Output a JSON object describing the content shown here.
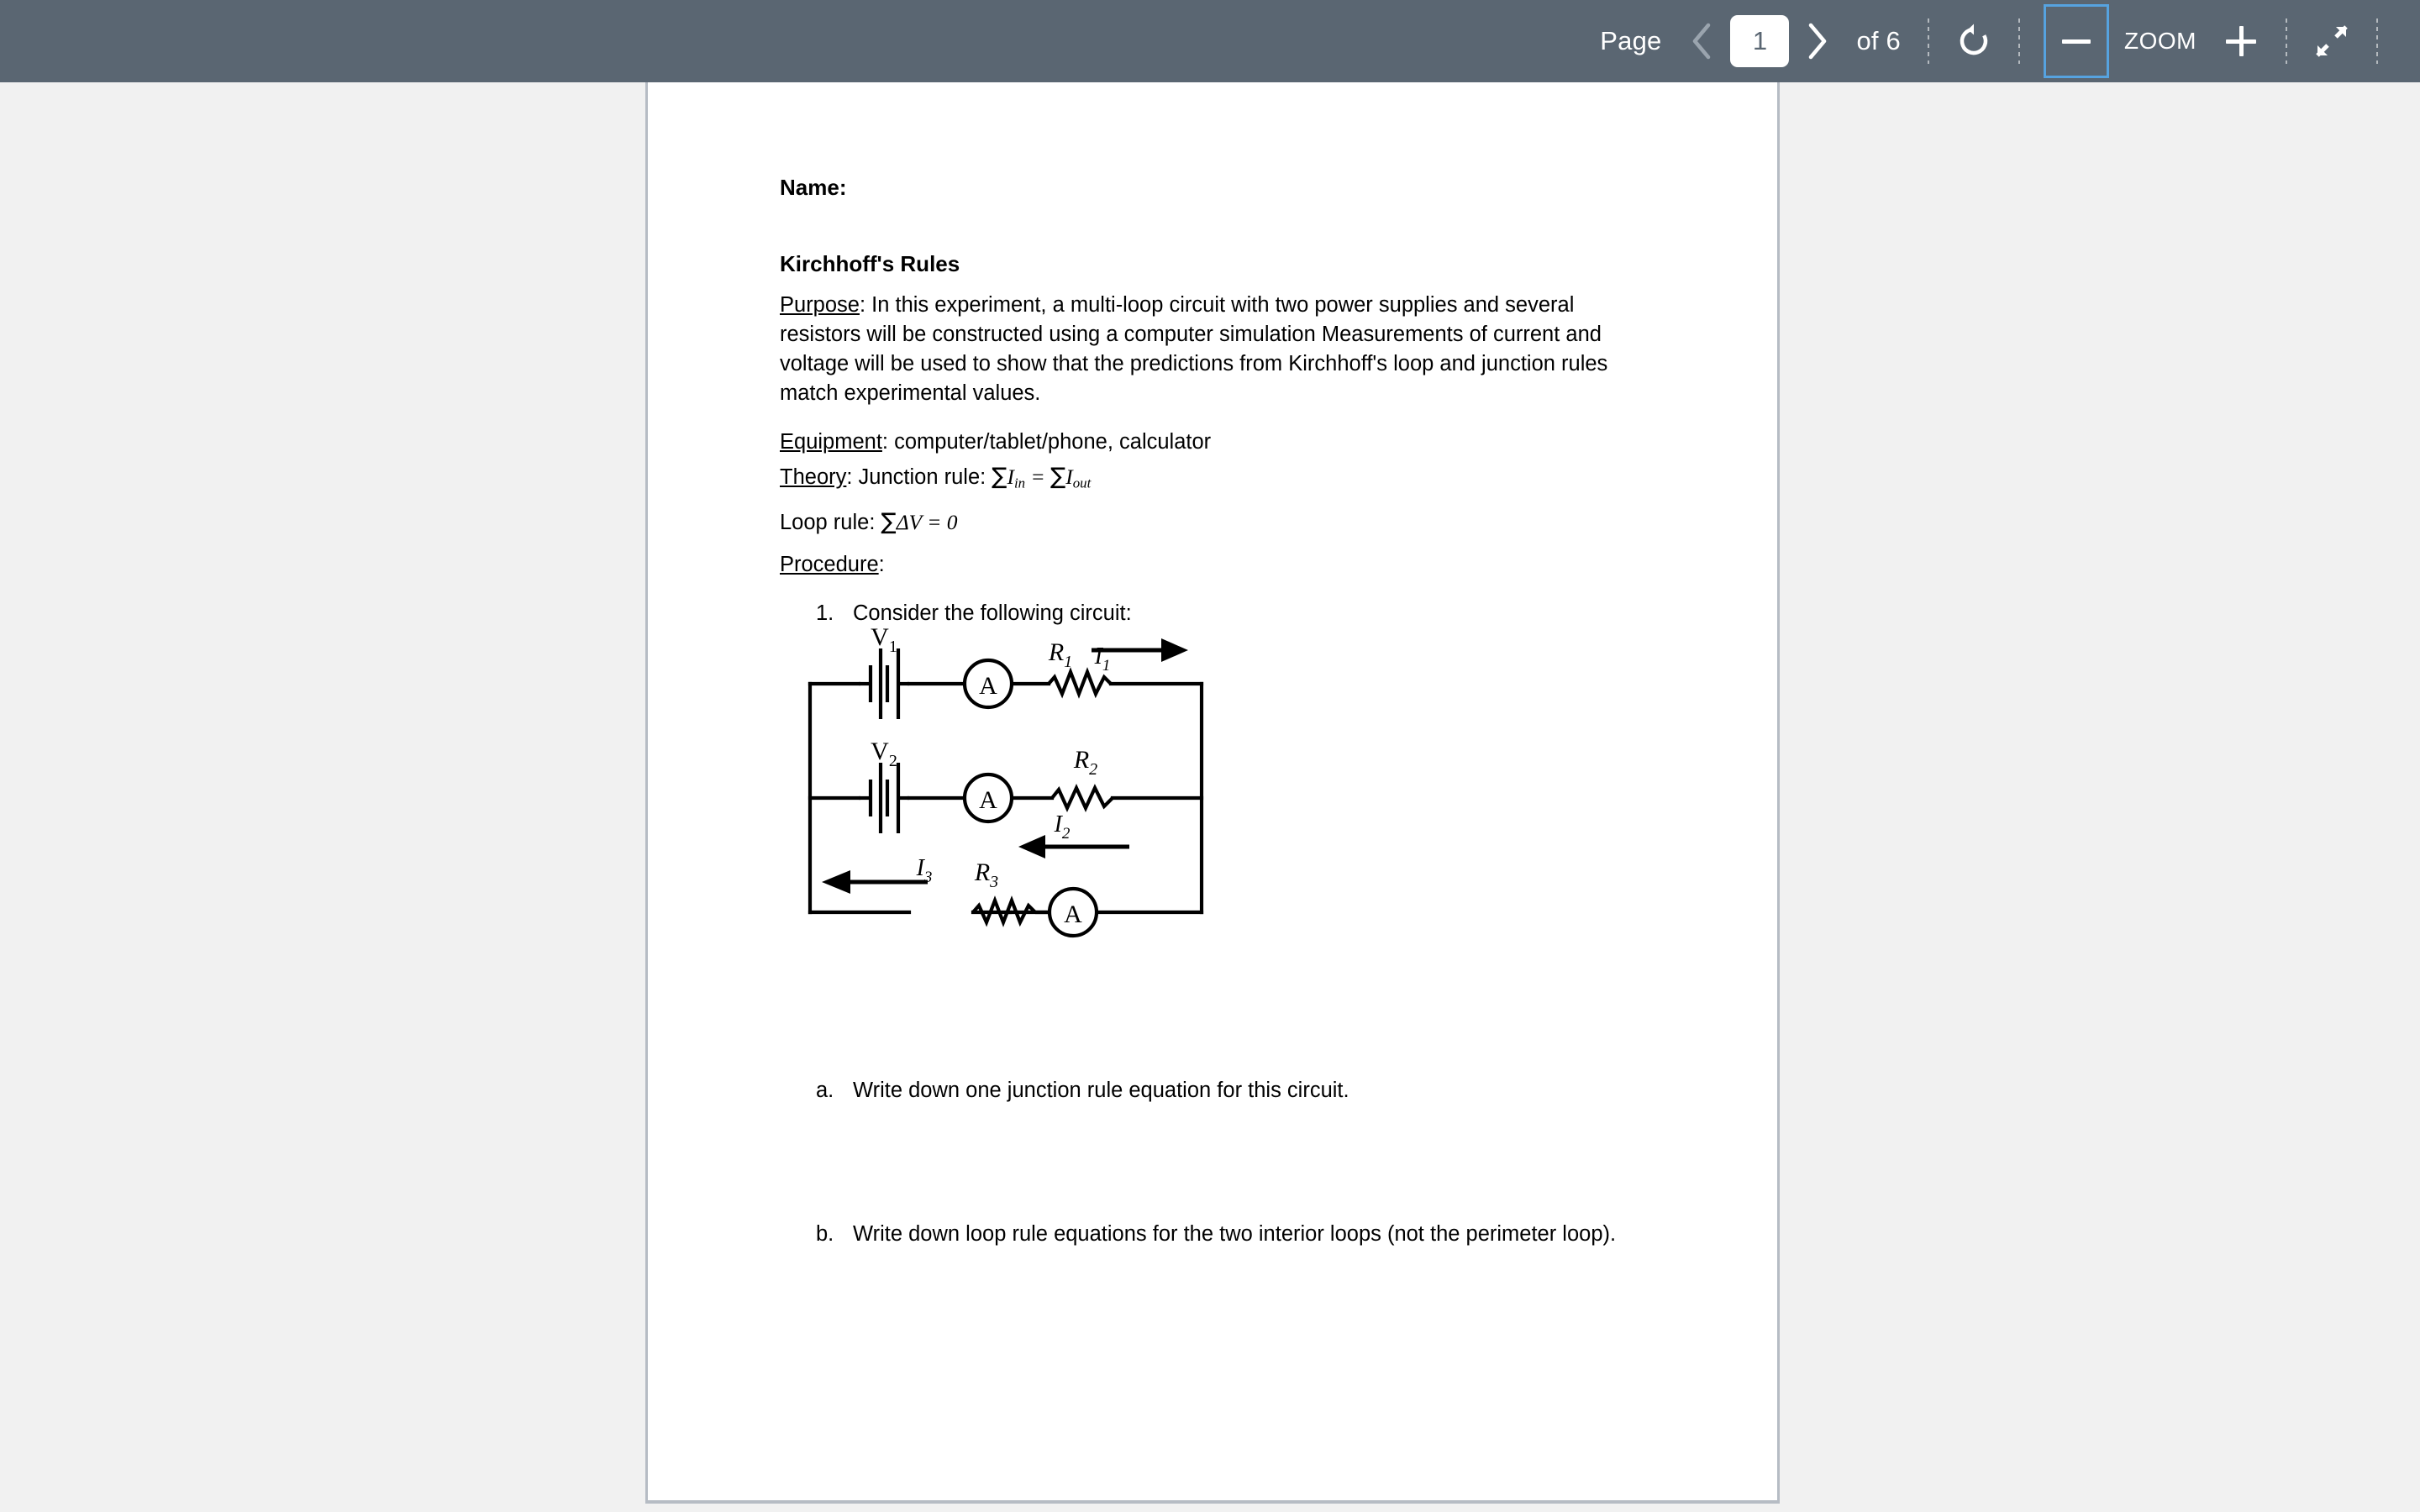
{
  "toolbar": {
    "page_label": "Page",
    "prev_icon": "chevron-left-icon",
    "page_value": "1",
    "next_icon": "chevron-right-icon",
    "of_label": "of 6",
    "rotate_icon": "rotate-icon",
    "zoom_out_icon": "minus-icon",
    "zoom_label": "ZOOM",
    "zoom_in_icon": "plus-icon",
    "collapse_icon": "collapse-fullscreen-icon",
    "accent_color": "#56a3e0",
    "background_color": "#5a6672"
  },
  "document": {
    "name_label": "Name:",
    "title": "Kirchhoff's Rules",
    "purpose_heading": "Purpose",
    "purpose_text": ":  In this experiment, a multi-loop circuit with two power supplies and several resistors will be constructed using a computer simulation  Measurements of current and voltage will be used to show that the predictions from Kirchhoff's loop and junction rules match experimental values.",
    "equipment_heading": "Equipment",
    "equipment_text": ":  computer/tablet/phone, calculator",
    "theory_heading": "Theory",
    "theory_text": ":   Junction rule:  ",
    "junction_sum_in": "∑",
    "junction_I_in": "I",
    "junction_sub_in": "in",
    "junction_equals": " = ",
    "junction_sum_out": "∑",
    "junction_I_out": "I",
    "junction_sub_out": "out",
    "loop_rule_label": "Loop rule: ",
    "loop_sum": "∑",
    "loop_delta_v": "ΔV",
    "loop_equals": " = 0",
    "procedure_heading": "Procedure",
    "procedure_colon": ":",
    "item1_number": "1.",
    "item1_text": "Consider the following circuit:",
    "question_a_number": "a.",
    "question_a_text": "Write down one junction rule equation for this circuit.",
    "question_b_number": "b.",
    "question_b_text": "Write down loop rule equations for the two interior loops (not the perimeter loop)."
  },
  "circuit": {
    "caption": "Multi-loop circuit with two batteries, three resistors and three ammeters",
    "labels": {
      "v1": "V",
      "v1_sub": "1",
      "v2": "V",
      "v2_sub": "2",
      "r1": "R",
      "r1_sub": "1",
      "r2": "R",
      "r2_sub": "2",
      "r3": "R",
      "r3_sub": "3",
      "i1": "I",
      "i1_sub": "1",
      "i2": "I",
      "i2_sub": "2",
      "i3": "I",
      "i3_sub": "3",
      "ammeter1": "A",
      "ammeter2": "A",
      "ammeter3": "A"
    }
  }
}
